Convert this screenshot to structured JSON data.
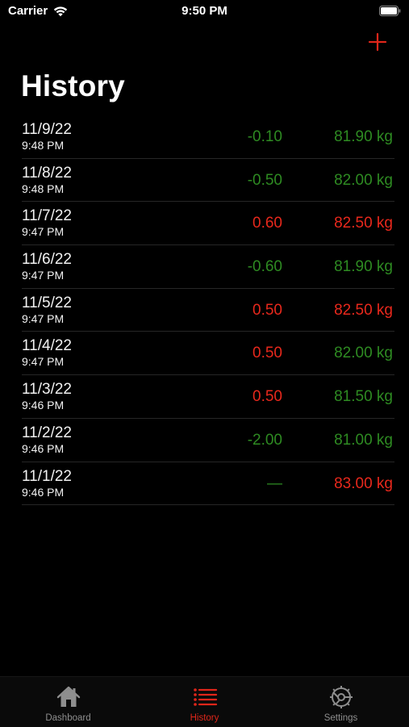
{
  "status_bar": {
    "carrier": "Carrier",
    "time": "9:50 PM"
  },
  "header": {
    "title": "History",
    "add_icon": "plus-icon"
  },
  "colors": {
    "accent": "#e0261a",
    "gain": "#e8281c",
    "loss": "#2e8b22",
    "background": "#000000"
  },
  "history": [
    {
      "date": "11/9/22",
      "time": "9:48 PM",
      "delta": "-0.10",
      "delta_color": "green",
      "weight": "81.90 kg",
      "weight_color": "green"
    },
    {
      "date": "11/8/22",
      "time": "9:48 PM",
      "delta": "-0.50",
      "delta_color": "green",
      "weight": "82.00 kg",
      "weight_color": "green"
    },
    {
      "date": "11/7/22",
      "time": "9:47 PM",
      "delta": "0.60",
      "delta_color": "red",
      "weight": "82.50 kg",
      "weight_color": "red"
    },
    {
      "date": "11/6/22",
      "time": "9:47 PM",
      "delta": "-0.60",
      "delta_color": "green",
      "weight": "81.90 kg",
      "weight_color": "green"
    },
    {
      "date": "11/5/22",
      "time": "9:47 PM",
      "delta": "0.50",
      "delta_color": "red",
      "weight": "82.50 kg",
      "weight_color": "red"
    },
    {
      "date": "11/4/22",
      "time": "9:47 PM",
      "delta": "0.50",
      "delta_color": "red",
      "weight": "82.00 kg",
      "weight_color": "green"
    },
    {
      "date": "11/3/22",
      "time": "9:46 PM",
      "delta": "0.50",
      "delta_color": "red",
      "weight": "81.50 kg",
      "weight_color": "green"
    },
    {
      "date": "11/2/22",
      "time": "9:46 PM",
      "delta": "-2.00",
      "delta_color": "green",
      "weight": "81.00 kg",
      "weight_color": "green"
    },
    {
      "date": "11/1/22",
      "time": "9:46 PM",
      "delta": "—",
      "delta_color": "green",
      "weight": "83.00 kg",
      "weight_color": "red"
    }
  ],
  "tab_bar": {
    "tabs": [
      {
        "label": "Dashboard",
        "icon": "house-icon",
        "active": false
      },
      {
        "label": "History",
        "icon": "list-icon",
        "active": true
      },
      {
        "label": "Settings",
        "icon": "gear-icon",
        "active": false
      }
    ]
  }
}
